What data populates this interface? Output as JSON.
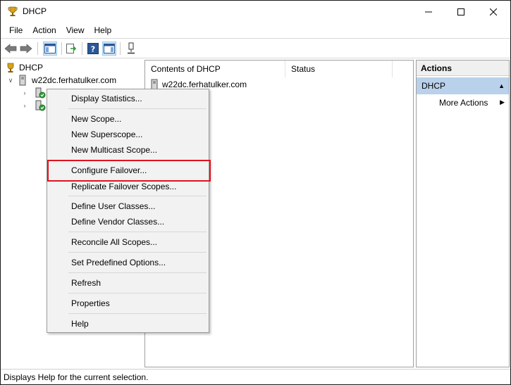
{
  "window": {
    "title": "DHCP",
    "icon": "trophy-icon"
  },
  "menubar": {
    "items": [
      "File",
      "Action",
      "View",
      "Help"
    ]
  },
  "tree": {
    "root": "DHCP",
    "server": "w22dc.ferhatulker.com"
  },
  "center": {
    "columns": [
      "Contents of DHCP",
      "Status"
    ],
    "rows": [
      "w22dc.ferhatulker.com"
    ]
  },
  "actions": {
    "title": "Actions",
    "section": "DHCP",
    "more": "More Actions"
  },
  "context_menu": {
    "items": [
      "Display Statistics...",
      "New Scope...",
      "New Superscope...",
      "New Multicast Scope...",
      "Configure Failover...",
      "Replicate Failover Scopes...",
      "Define User Classes...",
      "Define Vendor Classes...",
      "Reconcile All Scopes...",
      "Set Predefined Options...",
      "Refresh",
      "Properties",
      "Help"
    ],
    "highlighted": "Configure Failover..."
  },
  "status": {
    "text": "Displays Help for the current selection."
  },
  "colors": {
    "highlight_border": "#e0141e",
    "selection": "#b9d1ea"
  }
}
